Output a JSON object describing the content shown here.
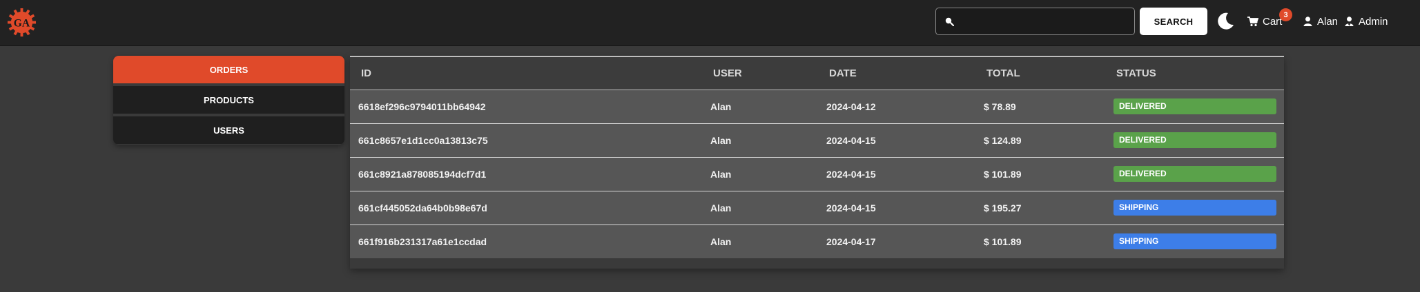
{
  "brand": {
    "logo_text": "GA",
    "logo_color": "#e04a2a"
  },
  "header": {
    "search_placeholder": "",
    "search_value": "",
    "search_button": "SEARCH",
    "cart_label": "Cart",
    "cart_count": "3",
    "user_name": "Alan",
    "admin_label": "Admin"
  },
  "sidebar": {
    "items": [
      {
        "label": "ORDERS",
        "active": true
      },
      {
        "label": "PRODUCTS",
        "active": false
      },
      {
        "label": "USERS",
        "active": false
      }
    ]
  },
  "orders": {
    "columns": [
      "ID",
      "USER",
      "DATE",
      "TOTAL",
      "STATUS"
    ],
    "rows": [
      {
        "id": "6618ef296c9794011bb64942",
        "user": "Alan",
        "date": "2024-04-12",
        "total": "$ 78.89",
        "status": "DELIVERED"
      },
      {
        "id": "661c8657e1d1cc0a13813c75",
        "user": "Alan",
        "date": "2024-04-15",
        "total": "$ 124.89",
        "status": "DELIVERED"
      },
      {
        "id": "661c8921a878085194dcf7d1",
        "user": "Alan",
        "date": "2024-04-15",
        "total": "$ 101.89",
        "status": "DELIVERED"
      },
      {
        "id": "661cf445052da64b0b98e67d",
        "user": "Alan",
        "date": "2024-04-15",
        "total": "$ 195.27",
        "status": "SHIPPING"
      },
      {
        "id": "661f916b231317a61e1ccdad",
        "user": "Alan",
        "date": "2024-04-17",
        "total": "$ 101.89",
        "status": "SHIPPING"
      }
    ]
  },
  "colors": {
    "accent": "#e04a2a",
    "delivered": "#5aa24a",
    "shipping": "#3d7ee8"
  }
}
